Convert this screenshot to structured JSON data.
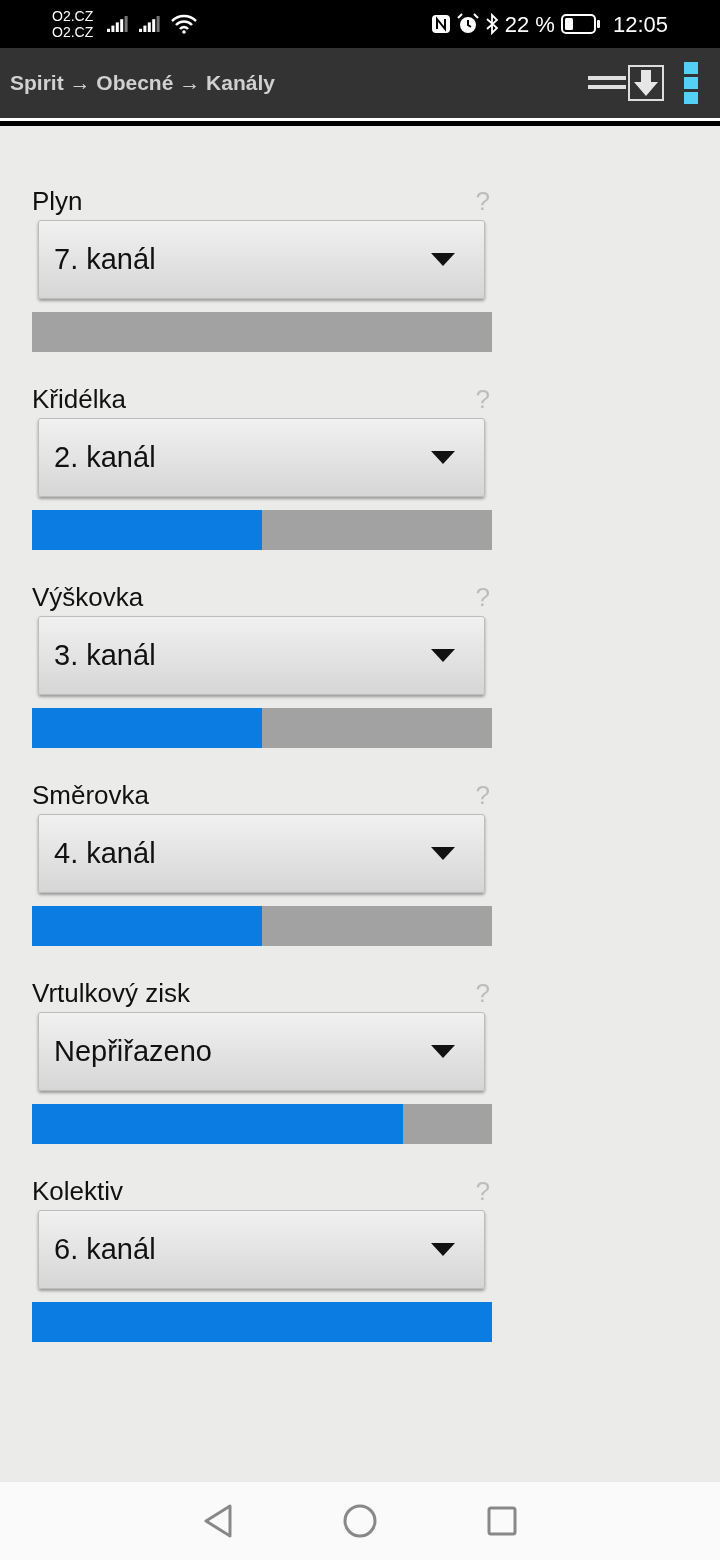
{
  "status_bar": {
    "carriers": [
      "O2.CZ",
      "O2.CZ"
    ],
    "battery": "22 %",
    "time": "12:05"
  },
  "header": {
    "breadcrumb": "Spirit → Obecné → Kanály"
  },
  "channels": [
    {
      "label": "Plyn",
      "help": "?",
      "value": "7. kanál",
      "level": 0
    },
    {
      "label": "Křidélka",
      "help": "?",
      "value": "2. kanál",
      "level": 0.5
    },
    {
      "label": "Výškovka",
      "help": "?",
      "value": "3. kanál",
      "level": 0.5
    },
    {
      "label": "Směrovka",
      "help": "?",
      "value": "4. kanál",
      "level": 0.5
    },
    {
      "label": "Vrtulkový zisk",
      "help": "?",
      "value": "Nepřiřazeno",
      "level": 0.806
    },
    {
      "label": "Kolektiv",
      "help": "?",
      "value": "6. kanál",
      "level": 1
    }
  ]
}
